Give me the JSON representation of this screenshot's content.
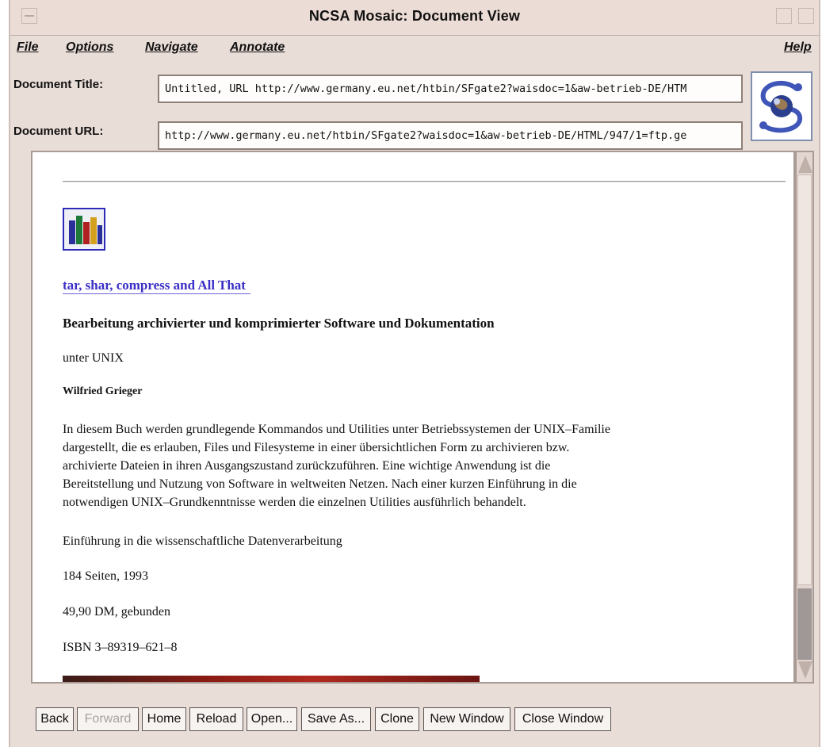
{
  "window": {
    "title": "NCSA Mosaic: Document View"
  },
  "menubar": {
    "items": [
      "File",
      "Options",
      "Navigate",
      "Annotate"
    ],
    "help": "Help"
  },
  "fields": {
    "title_label": "Document Title:",
    "title_value": "Untitled, URL http://www.germany.eu.net/htbin/SFgate2?waisdoc=1&aw-betrieb-DE/HTM",
    "url_label": "Document URL:",
    "url_value": "http://www.germany.eu.net/htbin/SFgate2?waisdoc=1&aw-betrieb-DE/HTML/947/1=ftp.ge"
  },
  "logo": {
    "icon": "mosaic-globe-logo-icon"
  },
  "document": {
    "link": "tar, shar, compress and All That",
    "heading": "Bearbeitung archivierter und komprimierter Software und Dokumentation",
    "subtitle": "unter UNIX",
    "author": "Wilfried Grieger",
    "paragraph_lines": [
      "In diesem Buch werden grundlegende Kommandos und Utilities unter Betriebssystemen der UNIX–Familie",
      "dargestellt, die es erlauben, Files und Filesysteme in einer übersichtlichen Form zu archivieren bzw.",
      "archivierte Dateien in ihren Ausgangszustand zurückzuführen. Eine wichtige Anwendung ist die",
      "Bereitstellung und Nutzung von Software in weltweiten Netzen. Nach einer kurzen Einführung in die",
      "notwendigen UNIX–Grundkenntnisse werden die einzelnen Utilities ausführlich behandelt."
    ],
    "series": "Einführung in die wissenschaftliche Datenverarbeitung",
    "pages": "184 Seiten, 1993",
    "price": "49,90 DM, gebunden",
    "isbn": "ISBN 3–89319–621–8"
  },
  "scroll": {
    "position": 0.0
  },
  "buttons": {
    "back": "Back",
    "forward": "Forward",
    "home": "Home",
    "reload": "Reload",
    "open": "Open...",
    "save_as": "Save As...",
    "clone": "Clone",
    "new_window": "New Window",
    "close_window": "Close Window"
  },
  "colors": {
    "link": "#3a2fc6",
    "window_bg": "#e9ddd8",
    "rule_bar": "#8a1b14"
  }
}
